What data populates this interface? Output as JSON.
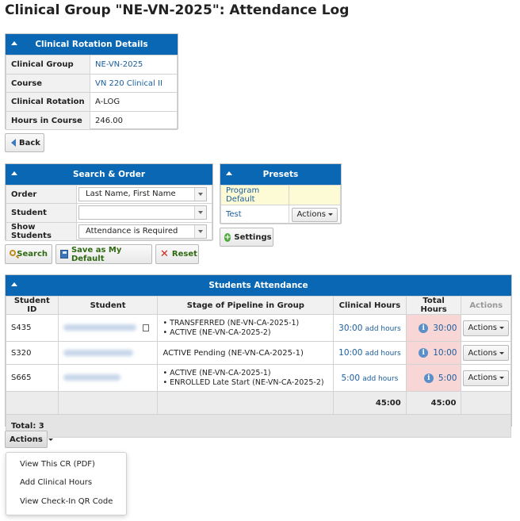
{
  "page": {
    "title": "Clinical Group \"NE-VN-2025\": Attendance Log"
  },
  "rotation": {
    "header": "Clinical Rotation Details",
    "rows": [
      {
        "label": "Clinical Group",
        "value": "NE-VN-2025"
      },
      {
        "label": "Course",
        "value": "VN 220 Clinical II"
      },
      {
        "label": "Clinical Rotation",
        "value": "A-LOG"
      },
      {
        "label": "Hours in Course",
        "value": "246.00"
      }
    ]
  },
  "back": {
    "label": "Back"
  },
  "search_order": {
    "header": "Search & Order",
    "order_label": "Order",
    "order_value": "Last Name, First Name",
    "student_label": "Student",
    "student_value": "",
    "show_label": "Show Students",
    "show_value": "Attendance is Required"
  },
  "presets": {
    "header": "Presets",
    "items": [
      "Program Default",
      "Test"
    ],
    "actions_label": "Actions",
    "settings_label": "Settings"
  },
  "buttons": {
    "search": "Search",
    "save_default": "Save as My Default",
    "reset": "Reset"
  },
  "attendance": {
    "header": "Students Attendance",
    "columns": [
      "Student ID",
      "Student",
      "Stage of Pipeline in Group",
      "Clinical Hours",
      "Total Hours",
      "Actions"
    ],
    "rows": [
      {
        "id": "S435",
        "stages": [
          "TRANSFERRED (NE-VN-CA-2025-1)",
          "ACTIVE (NE-VN-CA-2025-2)"
        ],
        "clinical": "30:00",
        "add": "add hours",
        "total": "30:00",
        "actions": "Actions"
      },
      {
        "id": "S320",
        "stages": [
          "ACTIVE Pending (NE-VN-CA-2025-1)"
        ],
        "clinical": "10:00",
        "add": "add hours",
        "total": "10:00",
        "actions": "Actions"
      },
      {
        "id": "S665",
        "stages": [
          "ACTIVE (NE-VN-CA-2025-1)",
          "ENROLLED Late Start (NE-VN-CA-2025-2)"
        ],
        "clinical": "5:00",
        "add": "add hours",
        "total": "5:00",
        "actions": "Actions"
      }
    ],
    "sum_clinical": "45:00",
    "sum_total": "45:00",
    "total_text": "Total: 3"
  },
  "bottom_actions": {
    "label": "Actions",
    "menu": [
      "View This CR (PDF)",
      "Add Clinical Hours",
      "View Check-In QR Code"
    ]
  },
  "colors": {
    "header_blue": "#0a67b3",
    "link": "#1a5e9e",
    "total_pink": "#f9d6d6",
    "preset_yellow": "#fdfbd5"
  }
}
